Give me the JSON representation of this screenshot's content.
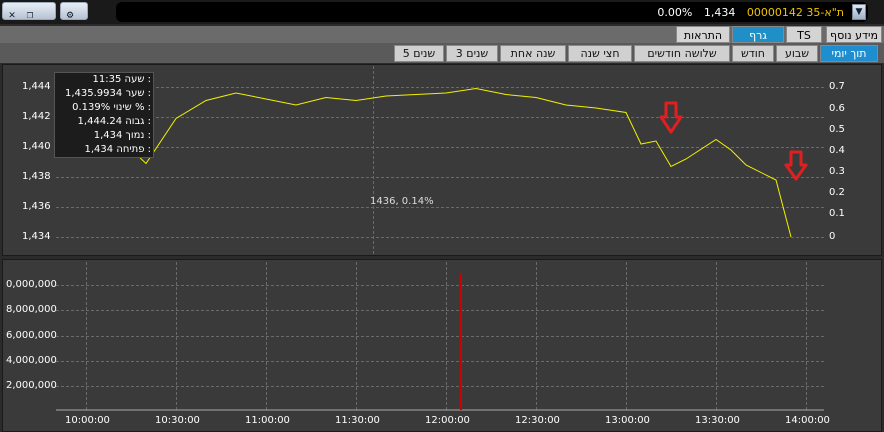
{
  "toolbar": {
    "buttons": [
      {
        "name": "close-icon",
        "glyph": "✕"
      },
      {
        "name": "restore-icon",
        "glyph": "❐"
      },
      {
        "name": "minimize-icon",
        "glyph": "–"
      },
      {
        "name": "settings-icon",
        "glyph": "⚙"
      }
    ]
  },
  "title": {
    "code": "00000142",
    "name": "ת\"א-35",
    "price": "1,434",
    "change": "0.00%"
  },
  "main_tabs": [
    "מידע נוסף",
    "TS",
    "גרף",
    "התראות"
  ],
  "main_tab_active": "גרף",
  "period_tabs": [
    "תוך יומי",
    "שבוע",
    "חודש",
    "שלושה חודשים",
    "חצי שנה",
    "שנה אחת",
    "3 שנים",
    "5 שנים"
  ],
  "period_tab_active": "תוך יומי",
  "info_box": {
    "rows": [
      {
        "label": "שעה :",
        "value": "11:35"
      },
      {
        "label": "שער :",
        "value": "1,435.9934"
      },
      {
        "label": "שינוי % :",
        "value": "0.139%"
      },
      {
        "label": "גבוה :",
        "value": "1,444.24"
      },
      {
        "label": "נמוך :",
        "value": "1,434"
      },
      {
        "label": "פתיחה :",
        "value": "1,434"
      }
    ]
  },
  "crosshair_label": "1436, 0.14%",
  "colors": {
    "price_line": "#f2f200",
    "volume_bar": "#d00000",
    "arrow": "#e02020",
    "accent_tab": "#1f8fc7"
  },
  "chart_data": [
    {
      "type": "line",
      "title": "",
      "x": [
        "10:00:00",
        "10:10:00",
        "10:20:00",
        "10:30:00",
        "10:40:00",
        "10:50:00",
        "11:00:00",
        "11:10:00",
        "11:20:00",
        "11:30:00",
        "11:40:00",
        "11:50:00",
        "12:00:00",
        "12:10:00",
        "12:20:00",
        "12:30:00",
        "12:40:00",
        "12:50:00",
        "13:00:00",
        "13:05:00",
        "13:10:00",
        "13:15:00",
        "13:20:00",
        "13:30:00",
        "13:35:00",
        "13:40:00",
        "13:50:00",
        "13:55:00"
      ],
      "series": [
        {
          "values": [
            1440.0,
            1440.8,
            1438.9,
            1441.9,
            1443.1,
            1443.6,
            1443.2,
            1442.8,
            1443.3,
            1443.1,
            1443.4,
            1443.5,
            1443.6,
            1443.9,
            1443.5,
            1443.3,
            1442.8,
            1442.6,
            1442.3,
            1440.2,
            1440.4,
            1438.7,
            1439.2,
            1440.5,
            1439.8,
            1438.8,
            1437.8,
            1434.0
          ]
        }
      ],
      "left_axis": {
        "ticks": [
          "1,434",
          "1,436",
          "1,438",
          "1,440",
          "1,442",
          "1,444"
        ],
        "ylim": [
          1433.5,
          1444.5
        ]
      },
      "right_axis": {
        "ticks": [
          "0",
          "0.1",
          "0.2",
          "0.3",
          "0.4",
          "0.5",
          "0.6",
          "0.7"
        ]
      },
      "grid": true
    },
    {
      "type": "bar",
      "title": "",
      "x": [
        "12:05:00"
      ],
      "values": [
        11000000
      ],
      "yaxis": {
        "ticks": [
          "2,000,000",
          "4,000,000",
          "6,000,000",
          "8,000,000",
          "0,000,000"
        ],
        "ylim": [
          0,
          11000000
        ]
      },
      "xticks": [
        "10:00:00",
        "10:30:00",
        "11:00:00",
        "11:30:00",
        "12:00:00",
        "12:30:00",
        "13:00:00",
        "13:30:00",
        "14:00:00"
      ],
      "grid": true
    }
  ]
}
